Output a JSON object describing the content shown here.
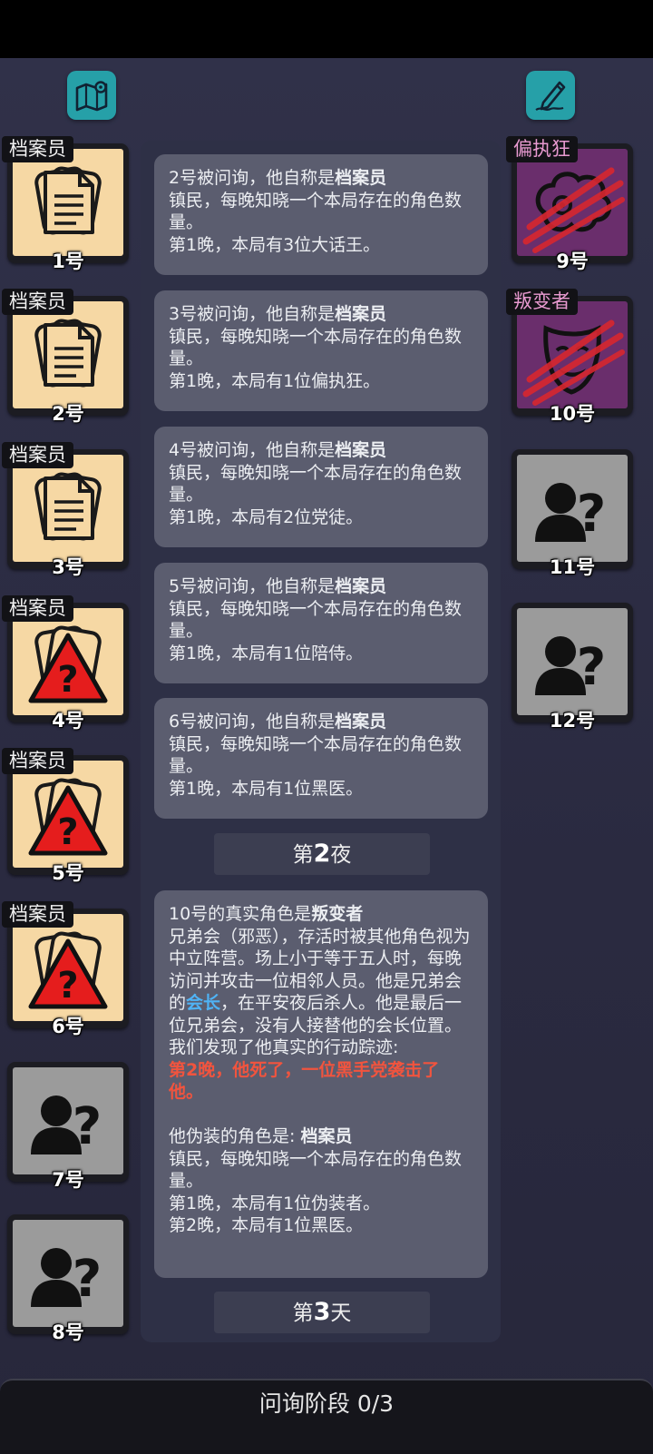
{
  "players_left": [
    {
      "num": "1号",
      "role": "档案员",
      "icon": "document-stack-icon"
    },
    {
      "num": "2号",
      "role": "档案员",
      "icon": "document-stack-icon"
    },
    {
      "num": "3号",
      "role": "档案员",
      "icon": "document-stack-icon"
    },
    {
      "num": "4号",
      "role": "档案员",
      "icon": "warning-question-icon"
    },
    {
      "num": "5号",
      "role": "档案员",
      "icon": "warning-question-icon"
    },
    {
      "num": "6号",
      "role": "档案员",
      "icon": "warning-question-icon"
    },
    {
      "num": "7号",
      "icon": "unknown-person-icon"
    },
    {
      "num": "8号",
      "icon": "unknown-person-icon"
    }
  ],
  "players_right": [
    {
      "num": "9号",
      "role": "偏执狂",
      "icon": "paranoid-brain-icon",
      "status": "dead"
    },
    {
      "num": "10号",
      "role": "叛变者",
      "icon": "theatre-mask-icon",
      "status": "dead"
    },
    {
      "num": "11号",
      "icon": "unknown-person-icon"
    },
    {
      "num": "12号",
      "icon": "unknown-person-icon"
    }
  ],
  "messages": [
    {
      "lead": "2号被问询，他自称是",
      "claim": "档案员",
      "line2": "镇民，每晚知晓一个本局存在的角色数量。",
      "line3": "第1晚，本局有3位大话王。"
    },
    {
      "lead": "3号被问询，他自称是",
      "claim": "档案员",
      "line2": "镇民，每晚知晓一个本局存在的角色数量。",
      "line3": "第1晚，本局有1位偏执狂。"
    },
    {
      "lead": "4号被问询，他自称是",
      "claim": "档案员",
      "line2": "镇民，每晚知晓一个本局存在的角色数量。",
      "line3": "第1晚，本局有2位党徒。"
    },
    {
      "lead": "5号被问询，他自称是",
      "claim": "档案员",
      "line2": "镇民，每晚知晓一个本局存在的角色数量。",
      "line3": "第1晚，本局有1位陪侍。"
    },
    {
      "lead": "6号被问询，他自称是",
      "claim": "档案员",
      "line2": "镇民，每晚知晓一个本局存在的角色数量。",
      "line3": "第1晚，本局有1位黑医。"
    }
  ],
  "divider_night": {
    "prefix": "第",
    "num": "2",
    "suffix": "夜"
  },
  "reveal": {
    "lead": "10号的真实角色是",
    "role": "叛变者",
    "desc_a": "兄弟会（邪恶），存活时被其他角色视为中立阵营。场上小于等于五人时，每晚访问并攻击一位相邻人员。他是兄弟会的",
    "desc_highlight": "会长",
    "desc_b": "，在平安夜后杀人。他是最后一位兄弟会，没有人接替他的会长位置。",
    "trace_label": "我们发现了他真实的行动踪迹:",
    "trace": "第2晚，他死了，一位黑手党袭击了他。",
    "disguise_lead": "他伪装的角色是: ",
    "disguise_role": "档案员",
    "disguise_desc": "镇民，每晚知晓一个本局存在的角色数量。",
    "night1": "第1晚，本局有1位伪装者。",
    "night2": "第2晚，本局有1位黑医。"
  },
  "divider_day": {
    "prefix": "第",
    "num": "3",
    "suffix": "天"
  },
  "phase": "问询阶段 0/3",
  "colors": {
    "accent_teal": "#26a0a8",
    "card_tan": "#f6d8a4",
    "evil_purple": "#6a2e6c",
    "warning_red": "#f1543e",
    "highlight_blue": "#4fb3f5"
  }
}
